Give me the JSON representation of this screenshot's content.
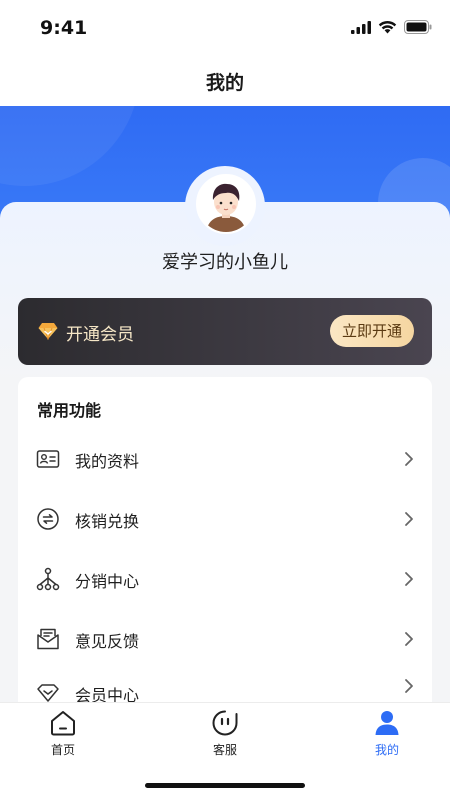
{
  "status_bar": {
    "time": "9:41"
  },
  "nav": {
    "title": "我的"
  },
  "profile": {
    "username": "爱学习的小鱼儿"
  },
  "vip": {
    "label": "开通会员",
    "button_label": "立即开通"
  },
  "functions": {
    "title": "常用功能",
    "items": [
      {
        "label": "我的资料",
        "icon": "id-card-icon"
      },
      {
        "label": "核销兑换",
        "icon": "exchange-icon"
      },
      {
        "label": "分销中心",
        "icon": "network-icon"
      },
      {
        "label": "意见反馈",
        "icon": "feedback-icon"
      },
      {
        "label": "会员中心",
        "icon": "vip-center-icon"
      }
    ]
  },
  "tabbar": {
    "tabs": [
      {
        "label": "首页",
        "icon": "home-icon"
      },
      {
        "label": "客服",
        "icon": "customer-service-icon"
      },
      {
        "label": "我的",
        "icon": "user-icon",
        "active": true
      }
    ]
  },
  "colors": {
    "primary": "#2d6cf5",
    "vip_gold": "#f5d6a1",
    "vip_dark": "#2c2b2f"
  }
}
